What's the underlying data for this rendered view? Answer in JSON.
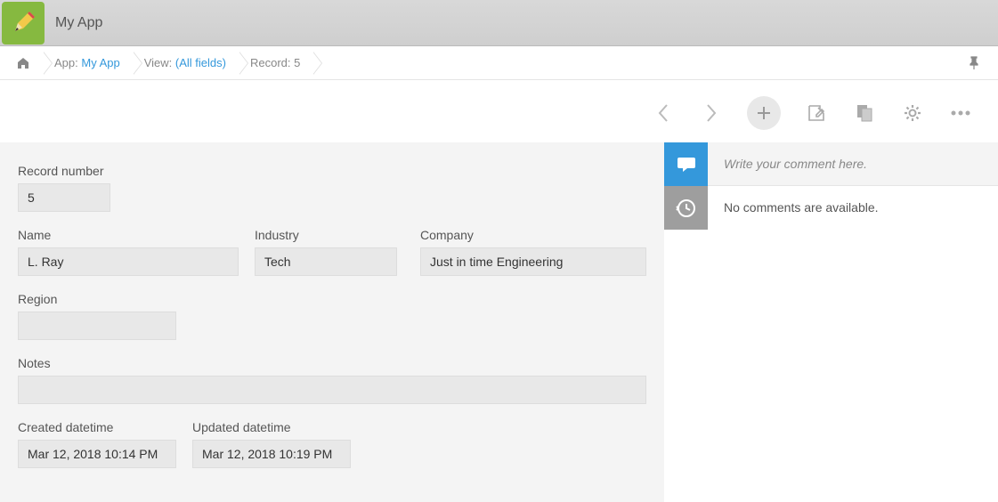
{
  "header": {
    "title": "My App"
  },
  "breadcrumbs": {
    "app_label": "App:",
    "app_link": "My App",
    "view_label": "View:",
    "view_link": "(All fields)",
    "record_label": "Record:",
    "record_value": "5"
  },
  "record": {
    "record_number": {
      "label": "Record number",
      "value": "5"
    },
    "name": {
      "label": "Name",
      "value": "L. Ray"
    },
    "industry": {
      "label": "Industry",
      "value": "Tech"
    },
    "company": {
      "label": "Company",
      "value": "Just in time Engineering"
    },
    "region": {
      "label": "Region",
      "value": ""
    },
    "notes": {
      "label": "Notes",
      "value": ""
    },
    "created": {
      "label": "Created datetime",
      "value": "Mar 12, 2018 10:14 PM"
    },
    "updated": {
      "label": "Updated datetime",
      "value": "Mar 12, 2018 10:19 PM"
    }
  },
  "comments": {
    "placeholder": "Write your comment here.",
    "empty": "No comments are available."
  }
}
